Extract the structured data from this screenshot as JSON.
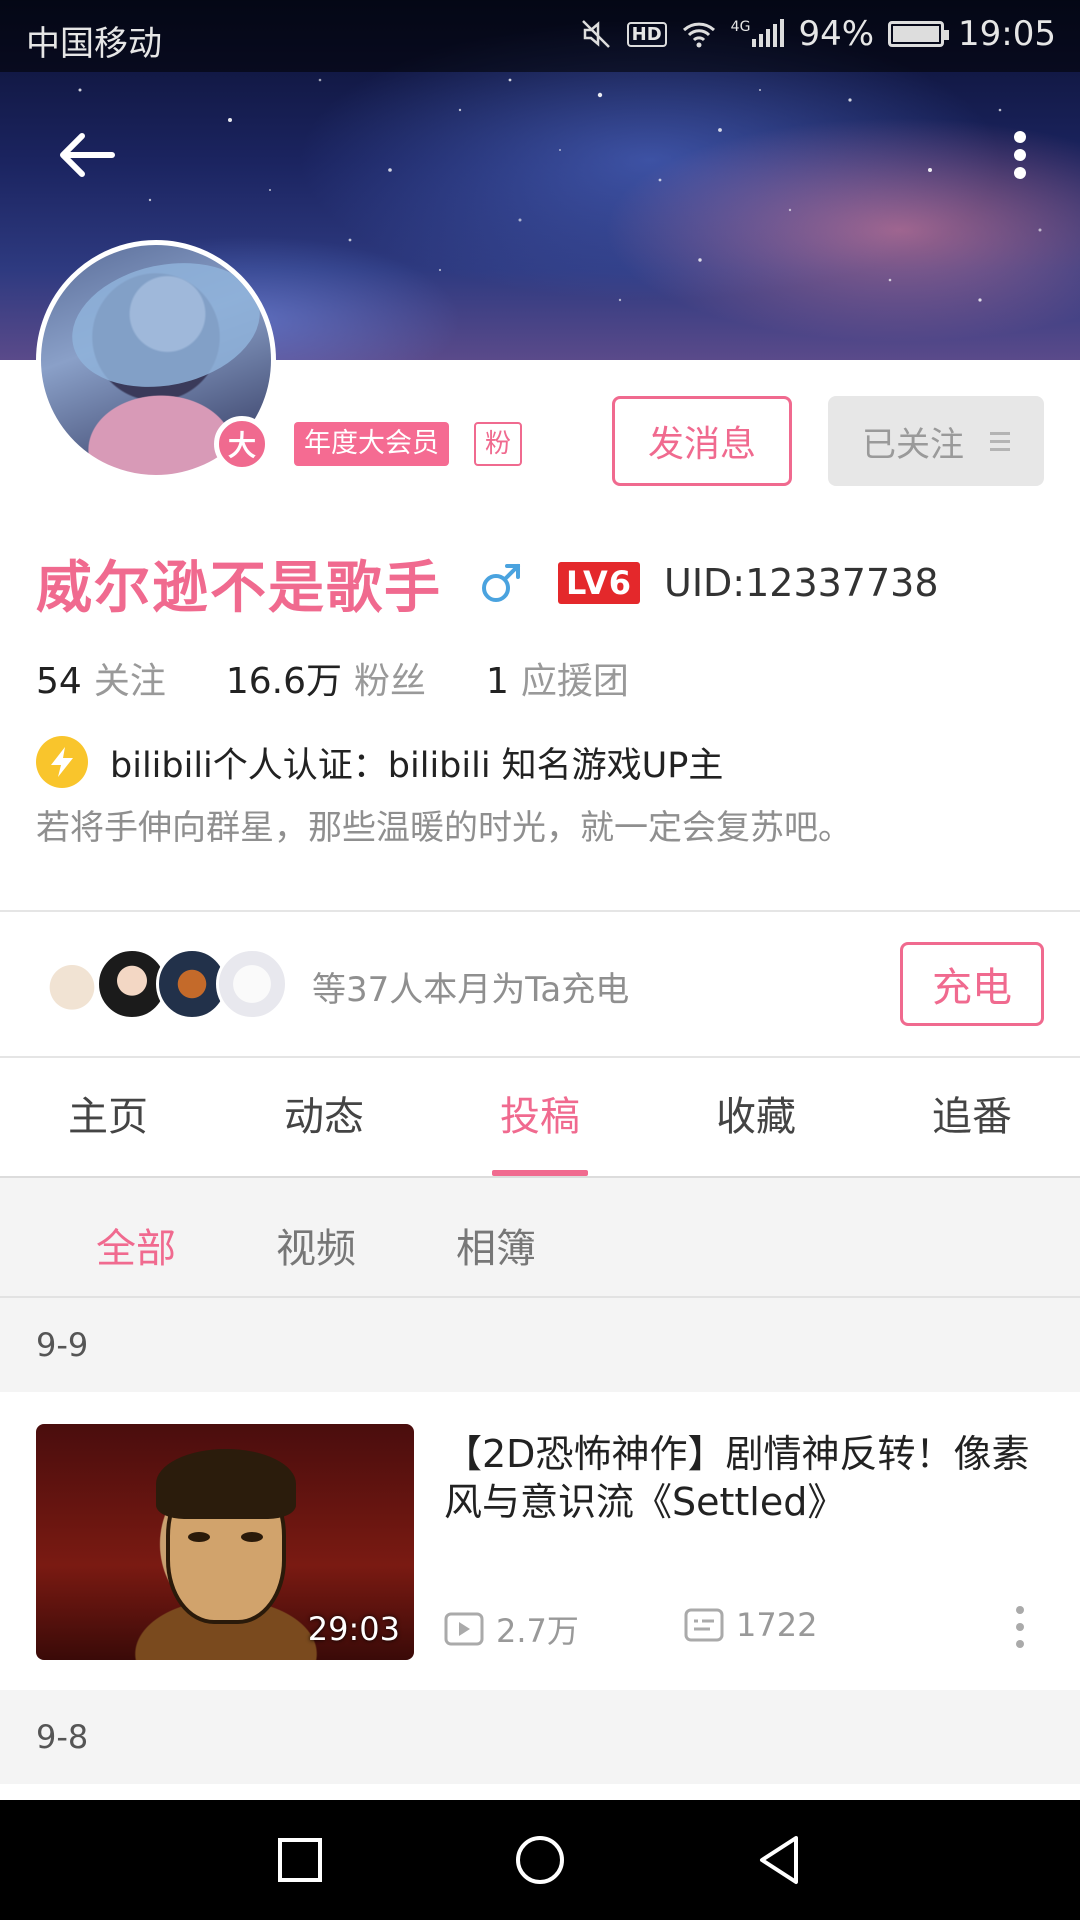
{
  "status_bar": {
    "carrier": "中国移动",
    "hd_label": "HD",
    "network": "4G",
    "battery": "94%",
    "battery_level": 0.94,
    "time": "19:05"
  },
  "profile": {
    "vip_avatar_badge": "大",
    "vip_badge": "年度大会员",
    "fan_badge": "粉",
    "message_button": "发消息",
    "follow_button": "已关注",
    "username": "威尔逊不是歌手",
    "gender_icon": "male-icon",
    "level_badge": "LV6",
    "uid": "UID:12337738",
    "stats": [
      {
        "num": "54",
        "label": "关注"
      },
      {
        "num": "16.6万",
        "label": "粉丝"
      },
      {
        "num": "1",
        "label": "应援团"
      }
    ],
    "verification": "bilibili个人认证：bilibili 知名游戏UP主",
    "signature": "若将手伸向群星，那些温暖的时光，就一定会复苏吧。"
  },
  "charge": {
    "text": "等37人本月为Ta充电",
    "button": "充电"
  },
  "tabs": [
    "主页",
    "动态",
    "投稿",
    "收藏",
    "追番"
  ],
  "active_tab": "投稿",
  "subtabs": [
    "全部",
    "视频",
    "相簿"
  ],
  "active_subtab": "全部",
  "feed": {
    "date1": "9-9",
    "video": {
      "title": "【2D恐怖神作】剧情神反转！像素风与意识流《Settled》",
      "duration": "29:03",
      "views": "2.7万",
      "danmaku": "1722"
    },
    "date2": "9-8"
  },
  "colors": {
    "accent": "#f06a8f",
    "level_red": "#e4282b",
    "verify_yellow": "#f9c52c"
  }
}
